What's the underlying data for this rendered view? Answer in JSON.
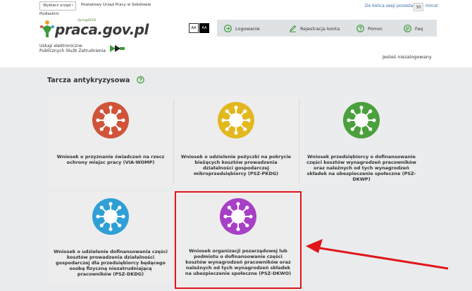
{
  "header": {
    "urzad_select_label": "Wybierz urząd",
    "urzad_name_line1": "Powiatowy Urząd Pracy w Sokołowie",
    "urzad_name_line2": "Podlaskim",
    "logo_text": "praca.gov.pl",
    "logo_sup": "Spring2018",
    "services_line1": "Usługi elektroniczne",
    "services_line2": "Publicznych Służb Zatrudnienia",
    "session_label": "Do końca sesji pozostało",
    "session_value": "30",
    "session_unit": "minut",
    "font_small": "AA",
    "font_large": "AA",
    "guest_status": "Jesteś niezalogowany"
  },
  "nav": {
    "items": [
      {
        "label": "Logowanie",
        "icon": "login-icon"
      },
      {
        "label": "Rejestracja konta",
        "icon": "pencil-icon"
      },
      {
        "label": "Pomoc",
        "icon": "help-icon"
      },
      {
        "label": "Faq",
        "icon": "chat-icon"
      }
    ]
  },
  "main": {
    "section_title": "Tarcza antykryzysowa",
    "tiles": [
      {
        "label": "Wniosek o przyznanie świadczeń na rzecz ochrony miejsc pracy (VIA-WOMP)",
        "color": "#d0533a"
      },
      {
        "label": "Wniosek o udzielenie pożyczki na pokrycie bieżących kosztów prowadzenia działalności gospodarczej mikroprzedsiębiorcy (PSZ-PKDG)",
        "color": "#e3b81f"
      },
      {
        "label": "Wniosek przedsiębiorcy o dofinansowanie części kosztów wynagrodzeń pracowników oraz należnych od tych wynagrodzeń składek na ubezpieczenie społeczne (PSZ-DKWP)",
        "color": "#4aa03c"
      },
      {
        "label": "Wniosek o udzielenie dofinansowania części kosztów prowadzenia działalności gospodarczej dla przedsiębiorcy będącego osobą fizyczną niezatrudniającą pracowników (PSZ-DKDG)",
        "color": "#2f9fd6"
      },
      {
        "label": "Wniosek organizacji pozarządowej lub podmiotu o dofinansowanie części kosztów wynagrodzeń pracowników oraz należnych od tych wynagrodzeń składek na ubezpieczenie społeczne (PSZ-DKWO)",
        "color": "#a83fc7"
      }
    ]
  },
  "colors": {
    "highlight": "#e0161a",
    "nav_bg": "#dfe2e5",
    "accent_green": "#3e9a3a"
  }
}
